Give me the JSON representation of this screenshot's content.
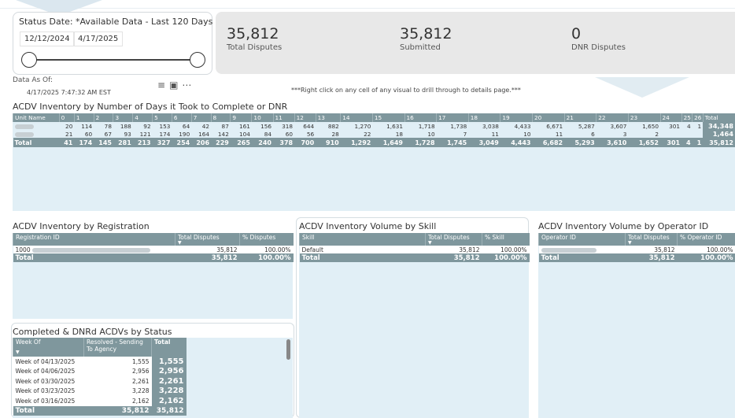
{
  "slicer": {
    "title": "Status Date: *Available Data - Last 120 Days",
    "start_date": "12/12/2024",
    "end_date": "4/17/2025"
  },
  "kpis": [
    {
      "value": "35,812",
      "label": "Total Disputes"
    },
    {
      "value": "35,812",
      "label": "Submitted"
    },
    {
      "value": "0",
      "label": "DNR Disputes"
    }
  ],
  "data_as_of": {
    "label": "Data As Of:",
    "value": "4/17/2025 7:47:32 AM EST"
  },
  "visual_icons": [
    "filter-icon",
    "focus-mode-icon",
    "more-options-icon"
  ],
  "hint": "***Right click on any cell of any visual to drill through to details page.***",
  "inventory_matrix": {
    "title": "ACDV Inventory by Number of Days it Took to Complete or DNR",
    "columns": [
      "Unit Name",
      "0",
      "1",
      "2",
      "3",
      "4",
      "5",
      "6",
      "7",
      "8",
      "9",
      "10",
      "11",
      "12",
      "13",
      "14",
      "15",
      "16",
      "17",
      "18",
      "19",
      "20",
      "21",
      "22",
      "23",
      "24",
      "25",
      "26",
      "Total"
    ],
    "rows": [
      [
        "",
        "20",
        "114",
        "78",
        "188",
        "92",
        "153",
        "64",
        "42",
        "87",
        "161",
        "156",
        "318",
        "644",
        "882",
        "1,270",
        "1,631",
        "1,718",
        "1,738",
        "3,038",
        "4,433",
        "6,671",
        "5,287",
        "3,607",
        "1,650",
        "301",
        "4",
        "1",
        "34,348"
      ],
      [
        "",
        "21",
        "60",
        "67",
        "93",
        "121",
        "174",
        "190",
        "164",
        "142",
        "104",
        "84",
        "60",
        "56",
        "28",
        "22",
        "18",
        "10",
        "7",
        "11",
        "10",
        "11",
        "6",
        "3",
        "2",
        "",
        "",
        "",
        "1,464"
      ]
    ],
    "total_row": [
      "Total",
      "41",
      "174",
      "145",
      "281",
      "213",
      "327",
      "254",
      "206",
      "229",
      "265",
      "240",
      "378",
      "700",
      "910",
      "1,292",
      "1,649",
      "1,728",
      "1,745",
      "3,049",
      "4,443",
      "6,682",
      "5,293",
      "3,610",
      "1,652",
      "301",
      "4",
      "1",
      "35,812"
    ]
  },
  "registration": {
    "title": "ACDV Inventory by Registration",
    "headers": [
      "Registration ID",
      "Total Disputes",
      "% Disputes"
    ],
    "rows": [
      [
        "1000",
        "35,812",
        "100.00%"
      ]
    ],
    "total": [
      "Total",
      "35,812",
      "100.00%"
    ]
  },
  "skill": {
    "title": "ACDV Inventory Volume by Skill",
    "headers": [
      "Skill",
      "Total Disputes",
      "% Skill"
    ],
    "rows": [
      [
        "Default",
        "35,812",
        "100.00%"
      ]
    ],
    "total": [
      "Total",
      "35,812",
      "100.00%"
    ]
  },
  "operator": {
    "title": "ACDV Inventory Volume by Operator ID",
    "headers": [
      "Operator ID",
      "Total Disputes",
      "% Operator ID"
    ],
    "rows": [
      [
        "",
        "35,812",
        "100.00%"
      ]
    ],
    "total": [
      "Total",
      "35,812",
      "100.00%"
    ]
  },
  "status": {
    "title": "Completed & DNRd ACDVs by Status",
    "headers": [
      "Week Of",
      "Resolved - Sending To Agency",
      "Total"
    ],
    "rows": [
      [
        "Week of 04/13/2025",
        "1,555",
        "1,555"
      ],
      [
        "Week of 04/06/2025",
        "2,956",
        "2,956"
      ],
      [
        "Week of 03/30/2025",
        "2,261",
        "2,261"
      ],
      [
        "Week of 03/23/2025",
        "3,228",
        "3,228"
      ],
      [
        "Week of 03/16/2025",
        "2,162",
        "2,162"
      ]
    ],
    "total": [
      "Total",
      "35,812",
      "35,812"
    ]
  }
}
